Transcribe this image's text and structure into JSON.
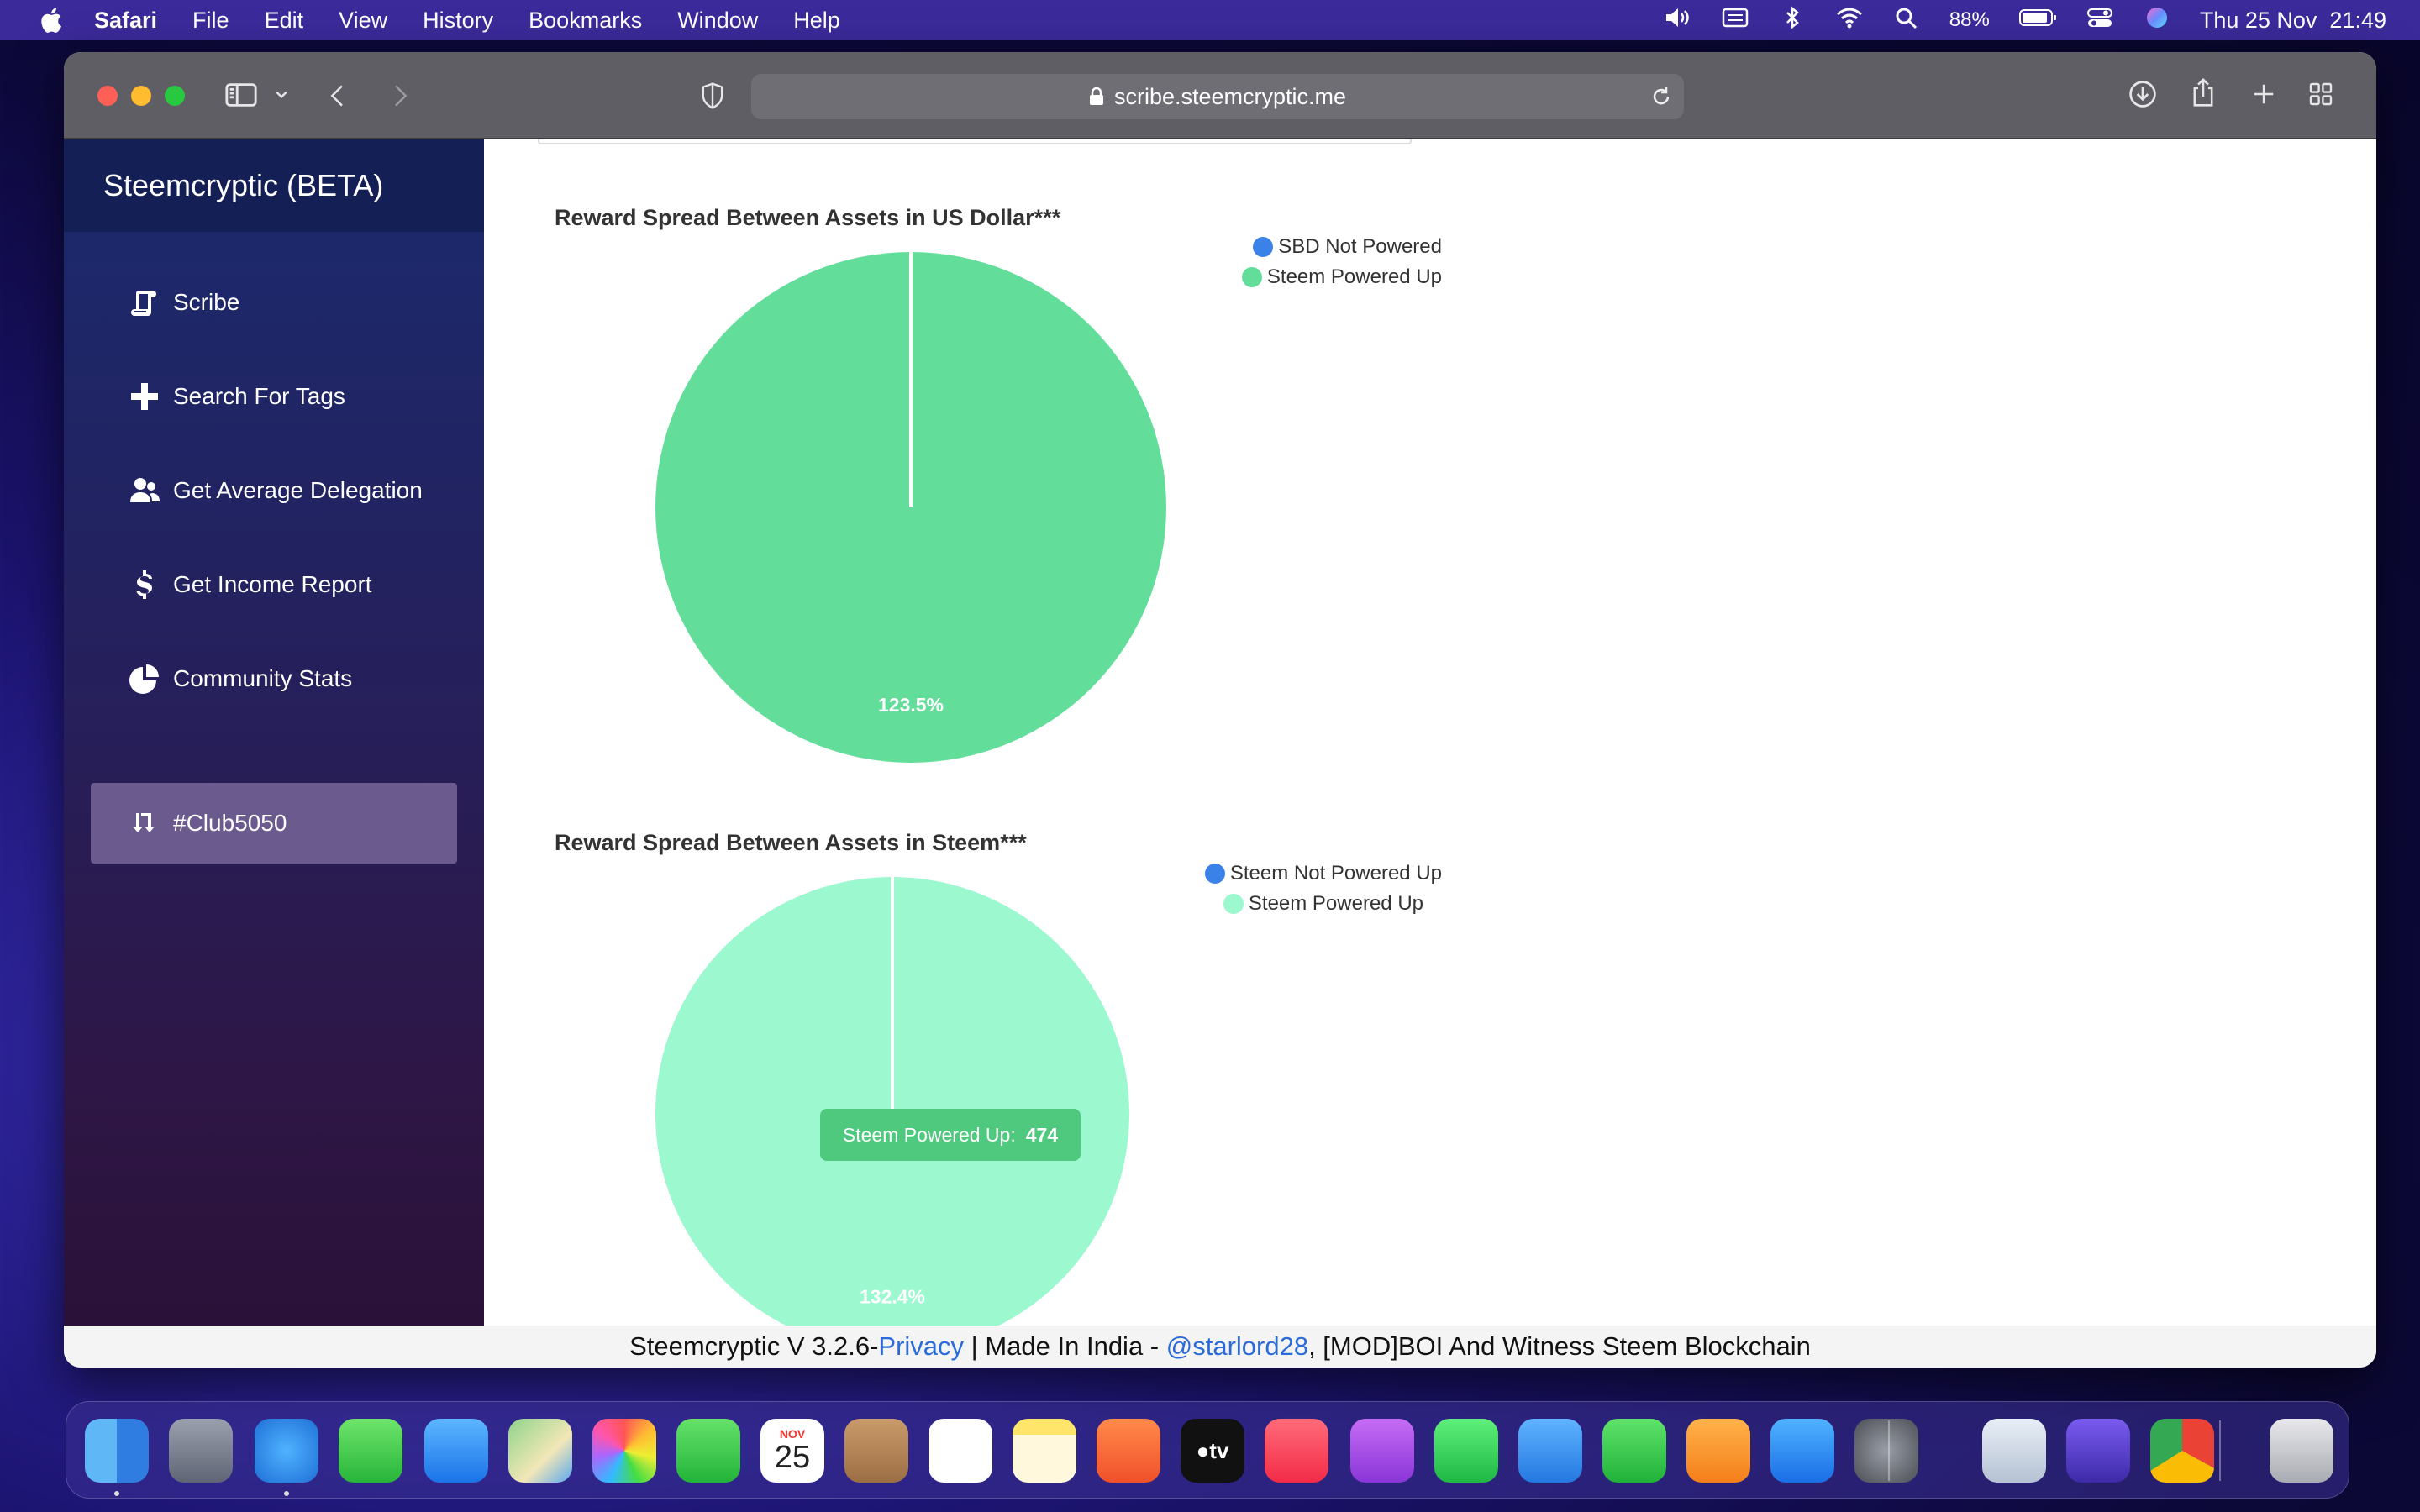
{
  "menubar": {
    "app_name": "Safari",
    "items": [
      "File",
      "Edit",
      "View",
      "History",
      "Bookmarks",
      "Window",
      "Help"
    ],
    "battery": "88%",
    "datetime": "Thu 25 Nov  21:49"
  },
  "browser": {
    "url": "scribe.steemcryptic.me"
  },
  "sidebar": {
    "brand": "Steemcryptic (BETA)",
    "items": [
      {
        "label": "Scribe",
        "icon": "scroll-icon"
      },
      {
        "label": "Search For Tags",
        "icon": "plus-icon"
      },
      {
        "label": "Get Average Delegation",
        "icon": "users-icon"
      },
      {
        "label": "Get Income Report",
        "icon": "dollar-icon"
      },
      {
        "label": "Community Stats",
        "icon": "pie-chart-icon"
      },
      {
        "label": "#Club5050",
        "icon": "retweet-icon",
        "active": true
      }
    ]
  },
  "chart_data": [
    {
      "type": "pie",
      "title": "Reward Spread Between Assets in US Dollar***",
      "labels": [
        "SBD Not Powered",
        "Steem Powered Up"
      ],
      "colors": [
        "#3b82e8",
        "#63dd9a"
      ],
      "values": [
        0,
        100
      ],
      "slice_labels": [
        "",
        "123.5%"
      ]
    },
    {
      "type": "pie",
      "title": "Reward Spread Between Assets in Steem***",
      "labels": [
        "Steem Not Powered Up",
        "Steem Powered Up"
      ],
      "colors": [
        "#3b82e8",
        "#9bf8cf"
      ],
      "values": [
        0,
        474
      ],
      "slice_labels": [
        "",
        "132.4%"
      ],
      "tooltip": {
        "label": "Steem Powered Up:",
        "value": "474"
      }
    }
  ],
  "footer": {
    "prefix": "Steemcryptic V 3.2.6-",
    "privacy": "Privacy",
    "middle": " | Made In India - ",
    "author": "@starlord28",
    "suffix": ", [MOD]BOI And Witness Steem Blockchain"
  },
  "dock": {
    "calendar_month": "NOV",
    "calendar_day": "25",
    "apps": [
      "Finder",
      "Launchpad",
      "Safari",
      "Messages",
      "Mail",
      "Maps",
      "Photos",
      "FaceTime",
      "Calendar",
      "Contacts",
      "Reminders",
      "Notes",
      "Swift Playgrounds",
      "TV",
      "Music",
      "Podcasts",
      "WhatsApp",
      "Keynote",
      "Numbers",
      "Pages",
      "App Store",
      "System Preferences",
      "Preview",
      "iMovie",
      "Chrome",
      "Trash"
    ]
  }
}
